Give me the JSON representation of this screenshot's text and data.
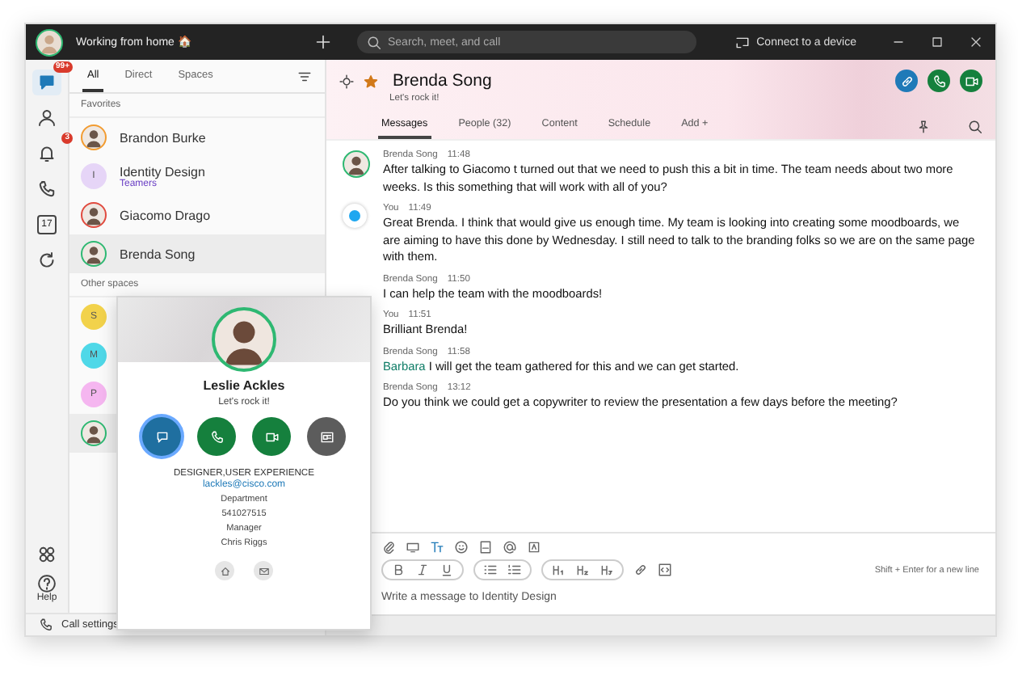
{
  "title_bar": {
    "status": "Working from home 🏠",
    "search_placeholder": "Search, meet, and call",
    "device_button": "Connect to a device"
  },
  "rail": {
    "items": [
      {
        "kind": "chat",
        "badge": "99+",
        "selected": true
      },
      {
        "kind": "people",
        "selected": false
      },
      {
        "kind": "activity",
        "badge": "3",
        "selected": false
      },
      {
        "kind": "calls",
        "selected": false
      },
      {
        "kind": "calendar",
        "label": "17",
        "selected": false
      },
      {
        "kind": "refresh",
        "selected": false
      }
    ],
    "help": "Help"
  },
  "list": {
    "tabs": [
      {
        "label": "All",
        "selected": true
      },
      {
        "label": "Direct",
        "selected": false
      },
      {
        "label": "Spaces",
        "selected": false
      }
    ],
    "sections": [
      {
        "title": "Favorites",
        "items": [
          {
            "kind": "person",
            "name": "Brandon Burke",
            "color": "#f29b30",
            "selected": false
          },
          {
            "kind": "space",
            "letter": "I",
            "color": "#e6d5f7",
            "name": "Identity Design",
            "subtitle": "Teamers",
            "selected": false
          },
          {
            "kind": "person",
            "name": "Giacomo Drago",
            "color": "#e04a3e",
            "selected": false
          },
          {
            "kind": "person",
            "name": "Brenda Song",
            "color": "#2eb872",
            "selected": true
          }
        ]
      },
      {
        "title": "Other spaces",
        "items": [
          {
            "kind": "space",
            "letter": "S",
            "color": "#f2d24b",
            "selected": false
          },
          {
            "kind": "space",
            "letter": "M",
            "color": "#4fd8e8",
            "selected": false
          },
          {
            "kind": "space",
            "letter": "P",
            "color": "#f5b6f0",
            "selected": false
          },
          {
            "kind": "person",
            "color": "#2eb872",
            "selected": true
          }
        ]
      }
    ],
    "call_settings": "Call settings"
  },
  "space": {
    "name": "Brenda Song",
    "status": "Let's rock it!",
    "favorite": true,
    "tabs": [
      {
        "label": "Messages",
        "selected": true
      },
      {
        "label": "People (32)",
        "selected": false
      },
      {
        "label": "Content",
        "selected": false
      },
      {
        "label": "Schedule",
        "selected": false
      },
      {
        "label": "Add +",
        "selected": false
      }
    ]
  },
  "messages": [
    {
      "author": "Brenda Song",
      "time": "11:48",
      "kind": "person",
      "text": "After talking to Giacomo t turned out that we need to push this a bit in time. The team needs about two more weeks. Is this something that will work with all of you?"
    },
    {
      "author": "You",
      "time": "11:49",
      "kind": "self",
      "text": "Great Brenda. I think that would give us enough time. My team is looking into creating some moodboards, we are aiming to have this done by Wednesday. I still need to talk to the branding folks so we are on the same page with them."
    },
    {
      "author": "Brenda Song",
      "time": "11:50",
      "text": "I can help the team with the moodboards!"
    },
    {
      "author": "You",
      "time": "11:51",
      "text": "Brilliant Brenda!"
    },
    {
      "author": "Brenda Song",
      "time": "11:58",
      "mention": "Barbara",
      "text": " I will get the team gathered for this and we can get started."
    },
    {
      "author": "Brenda Song",
      "time": "13:12",
      "text": "Do you think we could get a copywriter to review the presentation a few days before the meeting?"
    }
  ],
  "composer": {
    "tools": [
      {
        "kind": "attach"
      },
      {
        "kind": "share"
      },
      {
        "kind": "format"
      },
      {
        "kind": "emoji"
      },
      {
        "kind": "gif"
      },
      {
        "kind": "mention"
      },
      {
        "kind": "whiteboard"
      }
    ],
    "format_groups": [
      {
        "tools": [
          {
            "kind": "bold"
          },
          {
            "kind": "italic"
          },
          {
            "kind": "underline"
          }
        ]
      },
      {
        "tools": [
          {
            "kind": "bullets"
          },
          {
            "kind": "numbered"
          }
        ]
      },
      {
        "tools": [
          {
            "kind": "h1"
          },
          {
            "kind": "h2"
          },
          {
            "kind": "h3"
          }
        ]
      }
    ],
    "extra_tools": [
      {
        "kind": "link"
      },
      {
        "kind": "codeblock"
      }
    ],
    "hint": "Shift + Enter for a new line",
    "placeholder": "Write a message to Identity Design"
  },
  "contact_card": {
    "name": "Leslie Ackles",
    "status": "Let's rock it!",
    "actions": [
      {
        "kind": "chat",
        "selected": true
      },
      {
        "kind": "phone",
        "selected": false
      },
      {
        "kind": "video",
        "selected": false
      },
      {
        "kind": "card",
        "selected": false
      }
    ],
    "title": "DESIGNER,USER EXPERIENCE",
    "email": "lackles@cisco.com",
    "details": [
      "Department",
      "541027515",
      "Manager",
      "Chris Riggs"
    ],
    "footer_actions": [
      {
        "kind": "home"
      },
      {
        "kind": "mail"
      }
    ]
  }
}
